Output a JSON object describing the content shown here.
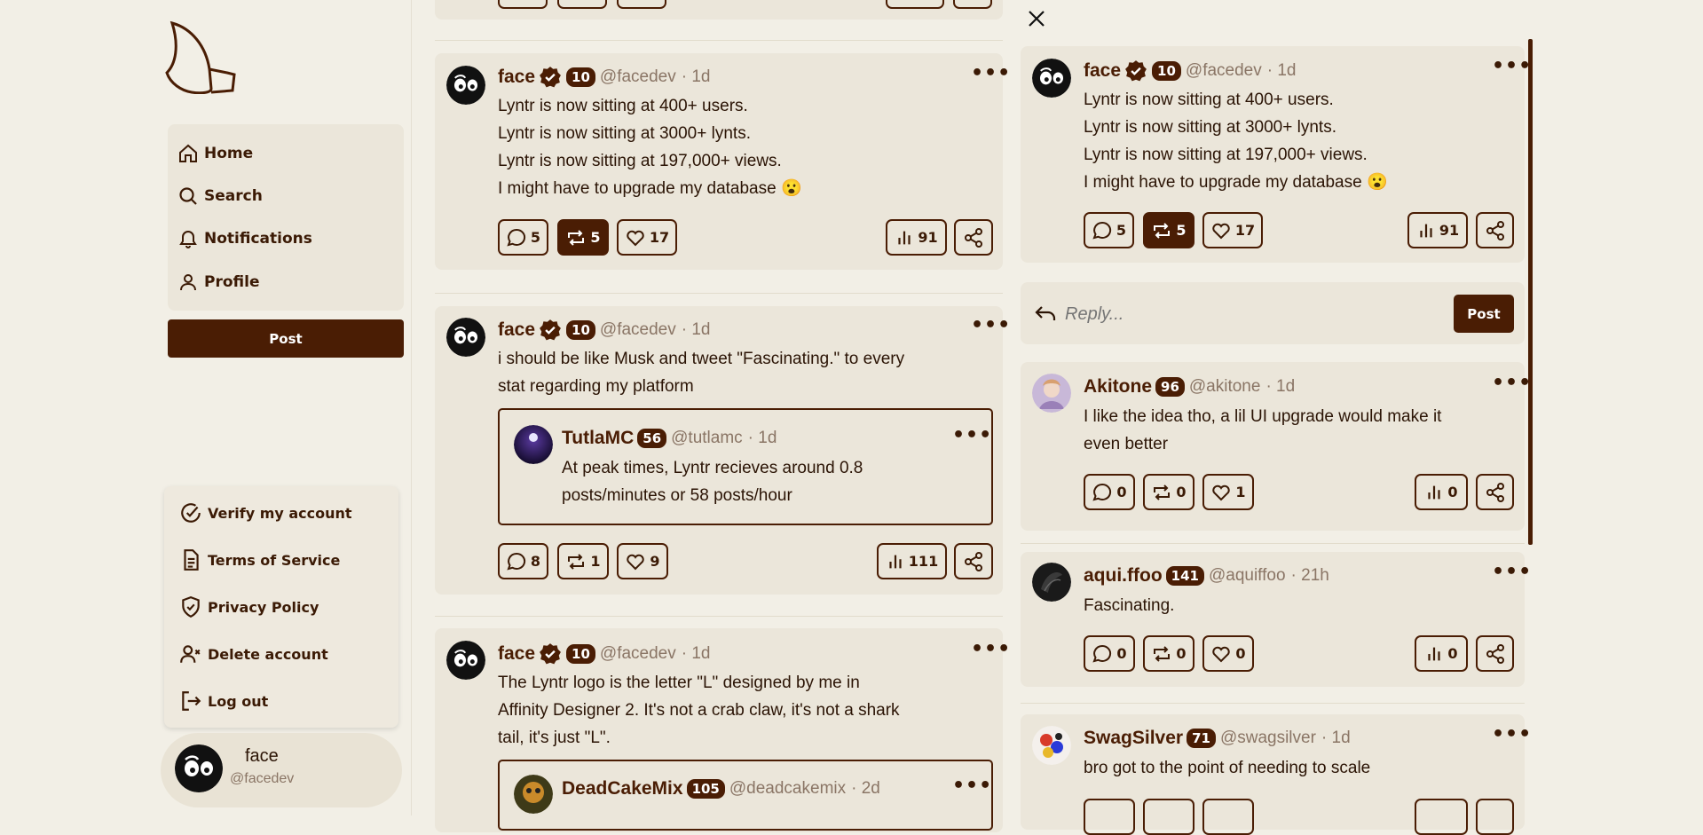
{
  "sidebar": {
    "nav": [
      {
        "label": "Home",
        "icon": "home-icon"
      },
      {
        "label": "Search",
        "icon": "search-icon"
      },
      {
        "label": "Notifications",
        "icon": "bell-icon"
      },
      {
        "label": "Profile",
        "icon": "user-icon"
      }
    ],
    "post_label": "Post",
    "menu": [
      {
        "label": "Verify my account",
        "icon": "verify-icon"
      },
      {
        "label": "Terms of Service",
        "icon": "document-icon"
      },
      {
        "label": "Privacy Policy",
        "icon": "shield-icon"
      },
      {
        "label": "Delete account",
        "icon": "user-remove-icon"
      },
      {
        "label": "Log out",
        "icon": "logout-icon"
      }
    ],
    "account": {
      "name": "face",
      "handle": "@facedev"
    }
  },
  "feed": [
    {
      "name": "face",
      "rank": "10",
      "handle": "@facedev",
      "time": "· 1d",
      "verified": true,
      "lines": [
        "Lyntr is now sitting at 400+ users.",
        "Lyntr is now sitting at 3000+ lynts.",
        "Lyntr is now sitting at 197,000+ views.",
        "I might have to upgrade my database 😮"
      ],
      "comments": "5",
      "reposts": "5",
      "likes": "17",
      "views": "91"
    },
    {
      "name": "face",
      "rank": "10",
      "handle": "@facedev",
      "time": "· 1d",
      "verified": true,
      "lines": [
        "i should be like Musk and tweet \"Fascinating.\" to every",
        "stat regarding my platform"
      ],
      "quote": {
        "name": "TutlaMC",
        "rank": "56",
        "handle": "@tutlamc",
        "time": "· 1d",
        "lines": [
          "At peak times, Lyntr recieves around 0.8",
          "posts/minutes or 58 posts/hour"
        ]
      },
      "comments": "8",
      "reposts": "1",
      "likes": "9",
      "views": "111"
    },
    {
      "name": "face",
      "rank": "10",
      "handle": "@facedev",
      "time": "· 1d",
      "verified": true,
      "lines": [
        "The Lyntr logo is the letter \"L\" designed by me in",
        "Affinity Designer 2. It's not a crab claw, it's not a shark",
        "tail, it's just \"L\"."
      ],
      "quote": {
        "name": "DeadCakeMix",
        "rank": "105",
        "handle": "@deadcakemix",
        "time": "· 2d"
      }
    }
  ],
  "detail": {
    "post": {
      "name": "face",
      "rank": "10",
      "handle": "@facedev",
      "time": "· 1d",
      "lines": [
        "Lyntr is now sitting at 400+ users.",
        "Lyntr is now sitting at 3000+ lynts.",
        "Lyntr is now sitting at 197,000+ views.",
        "I might have to upgrade my database 😮"
      ],
      "comments": "5",
      "reposts": "5",
      "likes": "17",
      "views": "91"
    },
    "reply_placeholder": "Reply...",
    "reply_post_label": "Post",
    "replies": [
      {
        "name": "Akitone",
        "rank": "96",
        "handle": "@akitone",
        "time": "· 1d",
        "lines": [
          "I like the idea tho, a lil UI upgrade would make it",
          "even better"
        ],
        "comments": "0",
        "reposts": "0",
        "likes": "1",
        "views": "0"
      },
      {
        "name": "aqui.ffoo",
        "rank": "141",
        "handle": "@aquiffoo",
        "time": "· 21h",
        "lines": [
          "Fascinating."
        ],
        "comments": "0",
        "reposts": "0",
        "likes": "0",
        "views": "0"
      },
      {
        "name": "SwagSilver",
        "rank": "71",
        "handle": "@swagsilver",
        "time": "· 1d",
        "lines": [
          "bro got to the point of needing to scale"
        ]
      }
    ]
  },
  "colors": {
    "accent": "#4a1d04",
    "background": "#f2efe6",
    "card": "#ebe6da",
    "muted": "#8a7565"
  }
}
